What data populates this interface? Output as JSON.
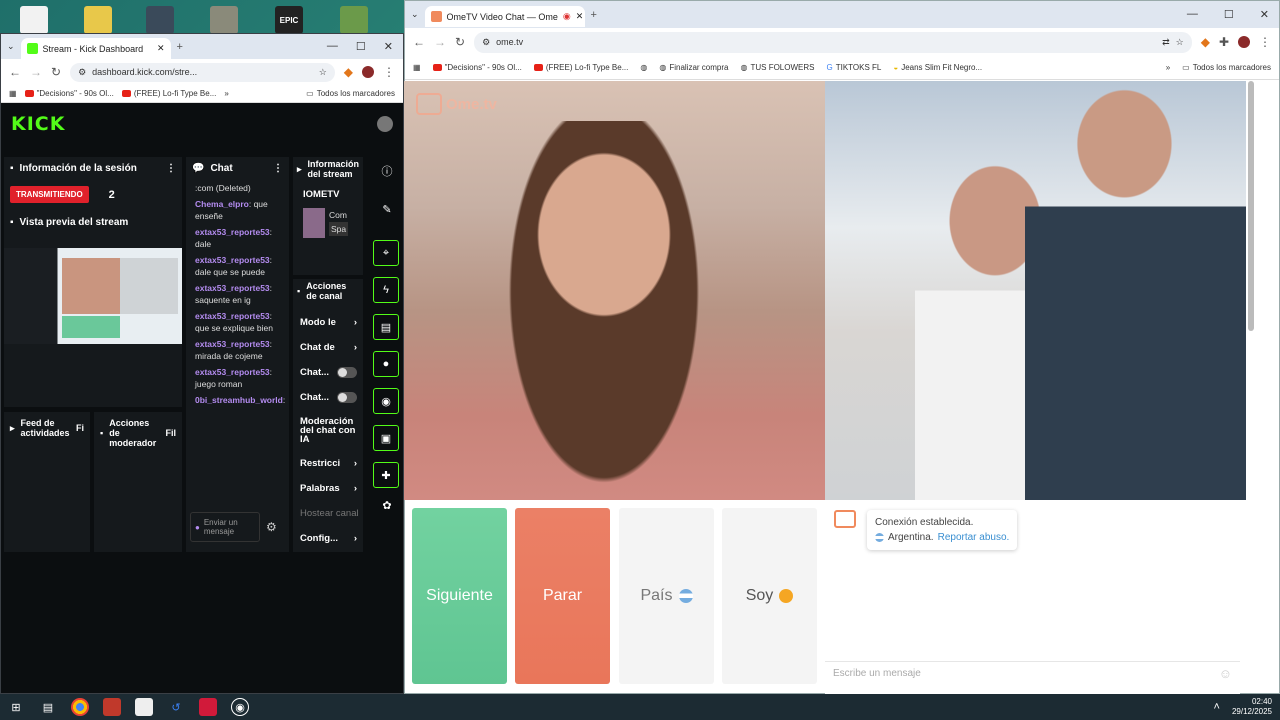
{
  "desktop": {
    "icons": [
      "file-icon",
      "file-icon",
      "game-icon",
      "game-icon",
      "epic-games-icon",
      "gta-icon"
    ],
    "epic_label": "EPIC"
  },
  "kick_window": {
    "tab_title": "Stream - Kick Dashboard",
    "url": "dashboard.kick.com/stre...",
    "bookmarks": [
      "\"Decisions\" - 90s Ol...",
      "(FREE) Lo-fi Type Be...",
      "Todos los marcadores"
    ],
    "logo": "KICK",
    "session": {
      "title": "Información de la sesión",
      "status": "TRANSMITIENDO",
      "viewers": "2",
      "preview_title": "Vista previa del stream"
    },
    "chat": {
      "title": "Chat",
      "messages": [
        {
          "user": "",
          "text": ":com (Deleted)"
        },
        {
          "user": "Chema_elpro",
          "text": ": que enseñe"
        },
        {
          "user": "extax53_reporte53",
          "text": ": dale"
        },
        {
          "user": "extax53_reporte53",
          "text": ": dale que se puede"
        },
        {
          "user": "extax53_reporte53",
          "text": ": saquente en ig"
        },
        {
          "user": "extax53_reporte53",
          "text": ": que se explique bien"
        },
        {
          "user": "extax53_reporte53",
          "text": ": mirada de cojeme"
        },
        {
          "user": "extax53_reporte53",
          "text": ": juego roman"
        },
        {
          "user": "0bi_streamhub_world",
          "text": ":"
        }
      ],
      "input_placeholder": "Enviar un mensaje"
    },
    "feed": {
      "title": "Feed de actividades",
      "filter": "Fi"
    },
    "mod": {
      "title": "Acciones de moderador",
      "filter": "Fil"
    },
    "stream_info": {
      "title": "Información del stream",
      "channel": "IOMETV",
      "line1": "Com",
      "line2": "Spa"
    },
    "channel_actions": {
      "title": "Acciones de canal",
      "items": [
        "Modo le",
        "Chat de",
        "Chat...",
        "Chat...",
        "Moderación del chat con IA",
        "Restricci",
        "Palabras",
        "Hostear canal",
        "Config..."
      ]
    }
  },
  "ome_window": {
    "tab_title": "OmeTV Video Chat — Ome",
    "url": "ome.tv",
    "bookmarks": [
      "\"Decisions\" - 90s Ol...",
      "(FREE) Lo-fi Type Be...",
      "Finalizar compra",
      "TUS FOLOWERS",
      "TIKTOKS FL",
      "Jeans Slim Fit Negro...",
      "Todos los marcadores"
    ],
    "watermark": "Ome.tv",
    "buttons": {
      "next": "Siguiente",
      "stop": "Parar",
      "country": "País",
      "gender": "Soy"
    },
    "status": {
      "line1": "Conexión establecida.",
      "country": "Argentina.",
      "report": "Reportar abuso."
    },
    "message_placeholder": "Escribe un mensaje"
  },
  "taskbar": {
    "time": "02:40",
    "date": "29/12/2025"
  },
  "colors": {
    "kick_green": "#53fc18",
    "ome_green": "#5fc592",
    "ome_red": "#e9765a",
    "transmit_red": "#e0212b"
  }
}
